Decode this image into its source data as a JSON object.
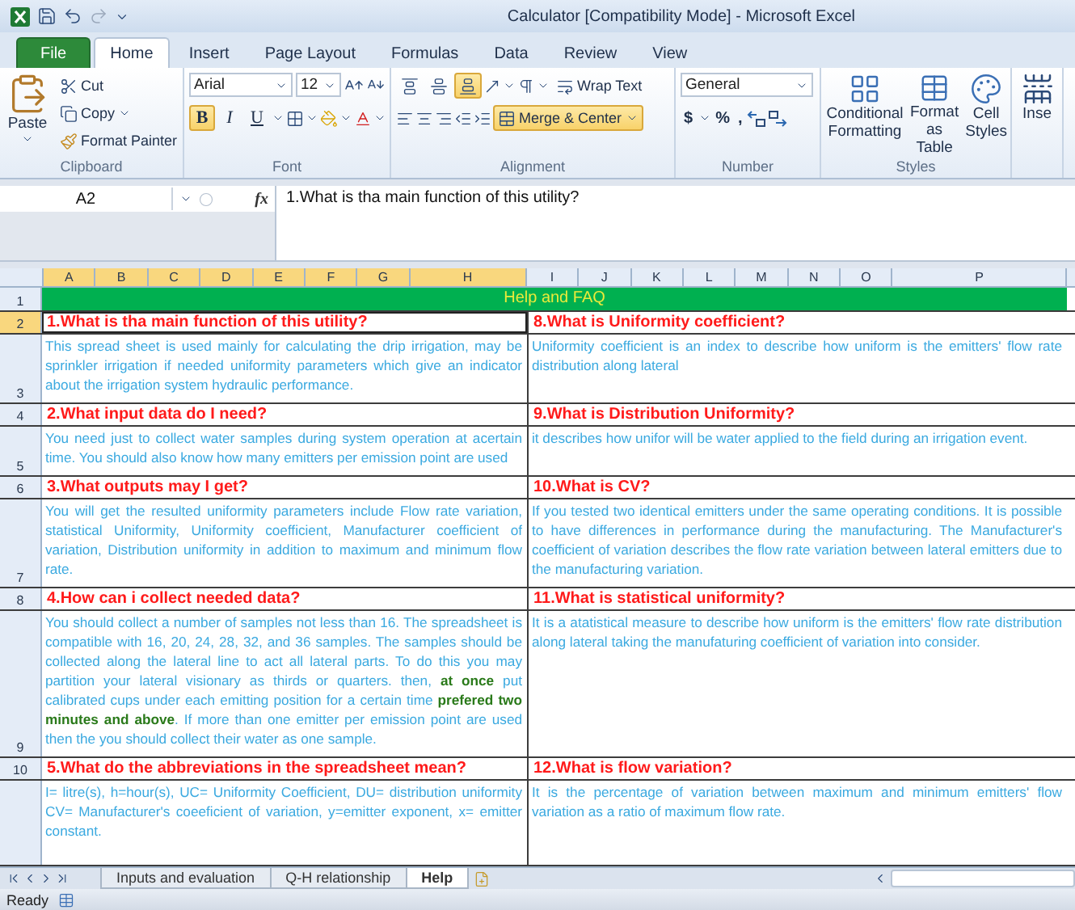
{
  "window": {
    "title": "Calculator [Compatibility Mode] - Microsoft Excel"
  },
  "ribbon": {
    "tabs": [
      {
        "label": "File",
        "kind": "file",
        "selected": false
      },
      {
        "label": "Home",
        "kind": "tab",
        "selected": true
      },
      {
        "label": "Insert",
        "kind": "tab",
        "selected": false
      },
      {
        "label": "Page Layout",
        "kind": "tab",
        "selected": false
      },
      {
        "label": "Formulas",
        "kind": "tab",
        "selected": false
      },
      {
        "label": "Data",
        "kind": "tab",
        "selected": false
      },
      {
        "label": "Review",
        "kind": "tab",
        "selected": false
      },
      {
        "label": "View",
        "kind": "tab",
        "selected": false
      }
    ],
    "clipboard": {
      "label": "Clipboard",
      "paste": "Paste",
      "cut": "Cut",
      "copy": "Copy",
      "format_painter": "Format Painter"
    },
    "font": {
      "label": "Font",
      "font_name": "Arial",
      "font_size": "12",
      "styles": [
        {
          "label": "B",
          "kind": "bold",
          "on": true
        },
        {
          "label": "I",
          "kind": "italic",
          "on": false
        },
        {
          "label": "U",
          "kind": "underline",
          "on": false
        }
      ]
    },
    "alignment": {
      "label": "Alignment",
      "vertical": [
        {
          "kind": "top",
          "on": false
        },
        {
          "kind": "middle",
          "on": false
        },
        {
          "kind": "bottom",
          "on": true
        }
      ],
      "wrap_text": {
        "label": "Wrap Text",
        "on": false
      },
      "merge_center": {
        "label": "Merge & Center",
        "on": true
      }
    },
    "number": {
      "label": "Number",
      "format": "General",
      "symbols": [
        "$",
        "%",
        ","
      ]
    },
    "styles": {
      "label": "Styles",
      "buttons": [
        {
          "label": "Conditional Formatting",
          "kind": "conditional"
        },
        {
          "label": "Format as Table",
          "kind": "table"
        },
        {
          "label": "Cell Styles",
          "kind": "cell"
        }
      ]
    },
    "cells": {
      "insert": "Inse"
    }
  },
  "formula_bar": {
    "name_box": "A2",
    "fx": "fx",
    "formula": "1.What is tha main function of this utility?"
  },
  "columns": [
    {
      "label": "A",
      "selected": true
    },
    {
      "label": "B",
      "selected": true
    },
    {
      "label": "C",
      "selected": true
    },
    {
      "label": "D",
      "selected": true
    },
    {
      "label": "E",
      "selected": true
    },
    {
      "label": "F",
      "selected": true
    },
    {
      "label": "G",
      "selected": true
    },
    {
      "label": "H",
      "selected": true
    },
    {
      "label": "I",
      "selected": false
    },
    {
      "label": "J",
      "selected": false
    },
    {
      "label": "K",
      "selected": false
    },
    {
      "label": "L",
      "selected": false
    },
    {
      "label": "M",
      "selected": false
    },
    {
      "label": "N",
      "selected": false
    },
    {
      "label": "O",
      "selected": false
    },
    {
      "label": "P",
      "selected": false
    }
  ],
  "sheet": {
    "title_row": {
      "row": {
        "label": "1",
        "selected": false
      },
      "text": "Help and FAQ"
    },
    "faq": [
      {
        "question_row": {
          "label": "2",
          "selected": true
        },
        "answer_row": {
          "label": "3",
          "selected": false
        },
        "left": {
          "question": "1.What is tha main function of this utility?",
          "selected": true,
          "answer": "This spread sheet is used mainly for calculating the drip irrigation, may be sprinkler irrigation if needed uniformity parameters which give an indicator about the irrigation system hydraulic performance."
        },
        "right": {
          "question": "8.What is Uniformity coefficient?",
          "selected": false,
          "answer": "Uniformity coefficient is an index to describe how uniform is the emitters' flow rate distribution along lateral"
        }
      },
      {
        "question_row": {
          "label": "4",
          "selected": false
        },
        "answer_row": {
          "label": "5",
          "selected": false
        },
        "left": {
          "question": "2.What input data do I need?",
          "selected": false,
          "answer": "You need just to collect water samples during system operation at acertain time. You should also know how many emitters per emission point are used"
        },
        "right": {
          "question": "9.What is Distribution Uniformity?",
          "selected": false,
          "answer": "it describes how unifor will be water applied to the field during an irrigation event."
        }
      },
      {
        "question_row": {
          "label": "6",
          "selected": false
        },
        "answer_row": {
          "label": "7",
          "selected": false
        },
        "left": {
          "question": "3.What outputs may I get?",
          "selected": false,
          "answer": "You will get the resulted uniformity parameters include Flow rate variation, statistical Uniformity, Uniformity coefficient, Manufacturer coefficient of variation, Distribution uniformity in addition to maximum and minimum flow rate."
        },
        "right": {
          "question": "10.What is CV?",
          "selected": false,
          "answer": "If you tested two identical emitters under the same operating conditions. It is possible to have differences in performance during the manufacturing. The Manufacturer's coefficient of variation describes the flow rate variation between lateral emitters due to the manufacturing variation."
        }
      },
      {
        "question_row": {
          "label": "8",
          "selected": false
        },
        "answer_row": {
          "label": "9",
          "selected": false
        },
        "left": {
          "question": "4.How can i collect needed data?",
          "selected": false,
          "answer": "You should collect a number of samples not less than 16. The spreadsheet is compatible with 16, 20, 24, 28, 32, and 36 samples. The samples should be collected along the lateral line to act all lateral parts. To do this you may partition your lateral visionary as thirds or quarters. then, **at once** put calibrated cups under each emitting position for a certain time **prefered two minutes and above**. If more than one emitter per emission point are used then the you should collect their water as one sample."
        },
        "right": {
          "question": "11.What is statistical uniformity?",
          "selected": false,
          "answer": "It is a atatistical measure to describe how uniform is the emitters' flow rate distribution along lateral taking the manufaturing coefficient of variation into consider."
        }
      },
      {
        "question_row": {
          "label": "10",
          "selected": false
        },
        "answer_row": {
          "selected": false
        },
        "left": {
          "question": "5.What do the abbreviations in the spreadsheet mean?",
          "selected": false,
          "answer": "I= litre(s), h=hour(s), UC= Uniformity Coefficient, DU= distribution uniformity CV= Manufacturer's coeeficient of variation, y=emitter exponent, x= emitter constant."
        },
        "right": {
          "question": "12.What is flow variation?",
          "selected": false,
          "answer": "It is the percentage of variation between maximum and minimum emitters' flow variation as a ratio of maximum flow rate."
        }
      }
    ]
  },
  "sheet_tabs": [
    {
      "label": "Inputs and evaluation",
      "selected": false
    },
    {
      "label": "Q-H relationship",
      "selected": false
    },
    {
      "label": "Help",
      "selected": true
    }
  ],
  "status_bar": {
    "text": "Ready"
  }
}
